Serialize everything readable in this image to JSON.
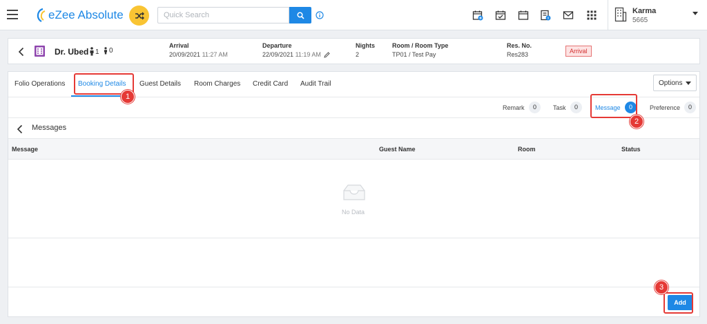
{
  "app": {
    "logo_text": "eZee Absolute",
    "search": {
      "placeholder": "Quick Search"
    },
    "user": {
      "name": "Karma",
      "code": "5665"
    }
  },
  "reservation": {
    "guest_name": "Dr. Ubed",
    "adults": "1",
    "children": "0",
    "arrival_label": "Arrival",
    "arrival_date": "20/09/2021",
    "arrival_time": "11:27 AM",
    "departure_label": "Departure",
    "departure_date": "22/09/2021",
    "departure_time": "11:19 AM",
    "nights_label": "Nights",
    "nights": "2",
    "room_label": "Room / Room Type",
    "room": "TP01 / Test Pay",
    "resno_label": "Res. No.",
    "resno": "Res283",
    "status": "Arrival"
  },
  "tabs": {
    "folio": "Folio Operations",
    "booking": "Booking Details",
    "guest": "Guest Details",
    "room_charges": "Room Charges",
    "credit_card": "Credit Card",
    "audit": "Audit Trail",
    "options": "Options"
  },
  "subtabs": {
    "remark_label": "Remark",
    "remark_count": "0",
    "task_label": "Task",
    "task_count": "0",
    "message_label": "Message",
    "message_count": "0",
    "preference_label": "Preference",
    "preference_count": "0"
  },
  "messages": {
    "title": "Messages",
    "columns": {
      "message": "Message",
      "guest_name": "Guest Name",
      "room": "Room",
      "status": "Status"
    },
    "empty_text": "No Data",
    "add_label": "Add"
  },
  "annotations": {
    "one": "1",
    "two": "2",
    "three": "3"
  },
  "colors": {
    "primary": "#1e88e5",
    "annotation": "#e53935",
    "accent": "#f9c433"
  }
}
